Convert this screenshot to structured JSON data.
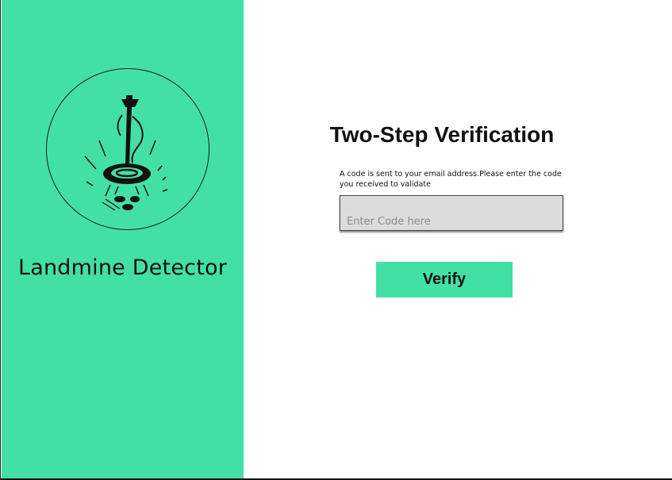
{
  "branding": {
    "app_name": "Landmine Detector",
    "logo_icon": "metal-detector-icon"
  },
  "verification": {
    "title": "Two-Step Verification",
    "instructions": "A code is sent to your email address.Please enter the code you received to validate",
    "code_input": {
      "placeholder": "Enter Code here",
      "value": ""
    },
    "verify_label": "Verify"
  },
  "colors": {
    "accent": "#43e0a6",
    "input_background": "#dcdcdc",
    "text": "#111111"
  }
}
